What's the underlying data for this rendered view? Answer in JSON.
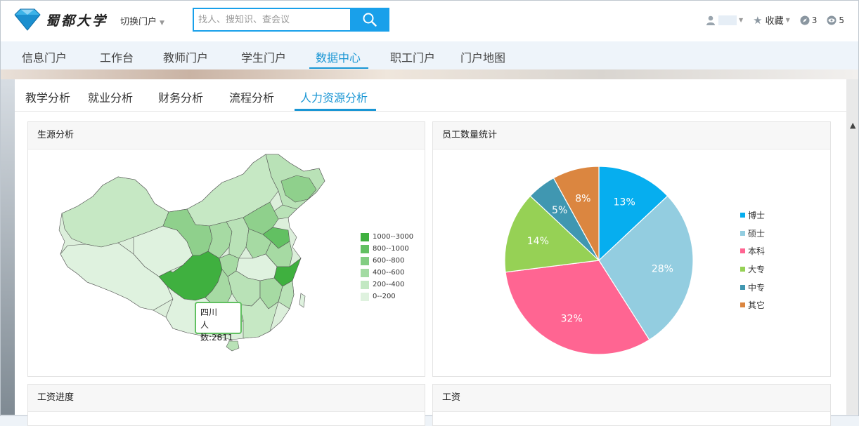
{
  "header": {
    "logo_text": "蜀都大学",
    "switch_portal": "切换门户",
    "search": {
      "placeholder": "找人、搜知识、查会议"
    },
    "favorites": "收藏",
    "compass_count": "3",
    "eye_count": "5"
  },
  "main_nav": {
    "items": [
      {
        "label": "信息门户"
      },
      {
        "label": "工作台"
      },
      {
        "label": "教师门户"
      },
      {
        "label": "学生门户"
      },
      {
        "label": "数据中心",
        "active": true
      },
      {
        "label": "职工门户"
      },
      {
        "label": "门户地图"
      }
    ]
  },
  "sub_nav": {
    "items": [
      {
        "label": "教学分析"
      },
      {
        "label": "就业分析"
      },
      {
        "label": "财务分析"
      },
      {
        "label": "流程分析"
      },
      {
        "label": "人力资源分析",
        "active": true
      }
    ]
  },
  "panels": {
    "source": {
      "title": "生源分析",
      "legend": [
        {
          "label": "1000--3000",
          "color": "#3fb03f"
        },
        {
          "label": "800--1000",
          "color": "#62c062"
        },
        {
          "label": "600--800",
          "color": "#82cd82"
        },
        {
          "label": "400--600",
          "color": "#a3dba3"
        },
        {
          "label": "200--400",
          "color": "#c2e8c2"
        },
        {
          "label": "0--200",
          "color": "#dff2df"
        }
      ],
      "tooltip": {
        "region": "四川",
        "value_text": "人数:2811"
      }
    },
    "staff": {
      "title": "员工数量统计"
    },
    "salary_progress": {
      "title": "工资进度"
    },
    "salary": {
      "title": "工资"
    }
  },
  "chart_data": {
    "type": "pie",
    "title": "员工数量统计",
    "slices": [
      {
        "label": "博士",
        "value": 13,
        "text": "13%",
        "color": "#06aeef"
      },
      {
        "label": "硕士",
        "value": 28,
        "text": "28%",
        "color": "#93cde0"
      },
      {
        "label": "本科",
        "value": 32,
        "text": "32%",
        "color": "#ff6592"
      },
      {
        "label": "大专",
        "value": 14,
        "text": "14%",
        "color": "#96d155"
      },
      {
        "label": "中专",
        "value": 5,
        "text": "5%",
        "color": "#4097b1"
      },
      {
        "label": "其它",
        "value": 8,
        "text": "8%",
        "color": "#db8640"
      }
    ],
    "legend_position": "right"
  }
}
